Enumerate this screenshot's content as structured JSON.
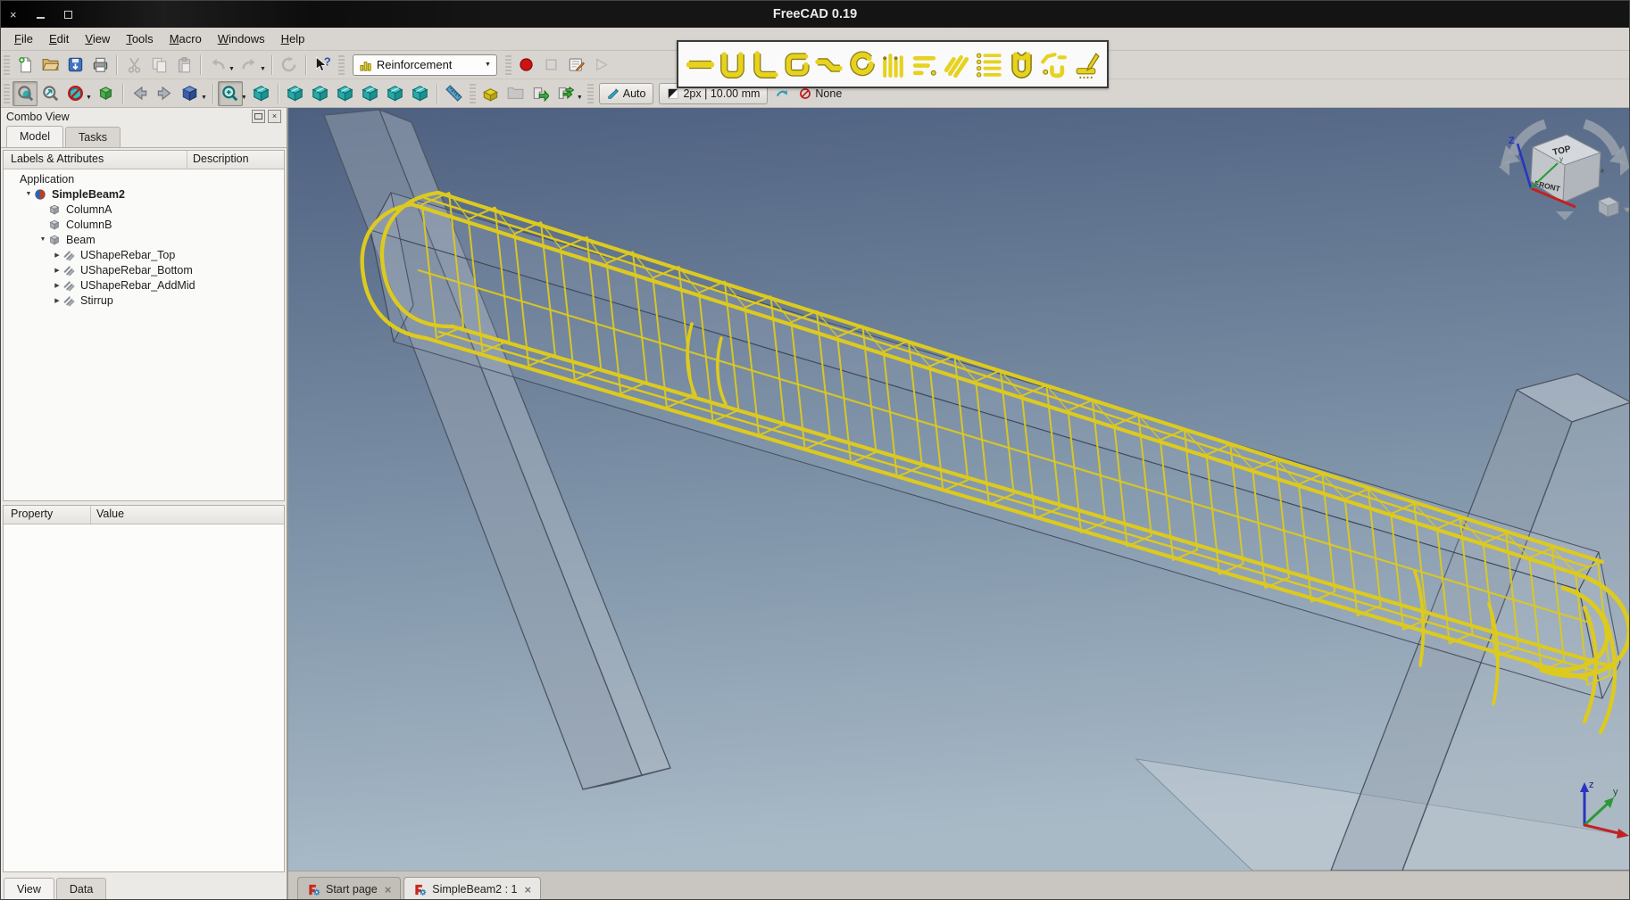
{
  "window": {
    "title": "FreeCAD 0.19",
    "controls": [
      "close",
      "minimize",
      "maximize"
    ]
  },
  "menubar": {
    "items": [
      "File",
      "Edit",
      "View",
      "Tools",
      "Macro",
      "Windows",
      "Help"
    ]
  },
  "toolbars": {
    "file": {
      "groups": [
        [
          "new-file",
          "open-folder",
          "save",
          "print"
        ],
        [
          "cut",
          "copy",
          "paste"
        ],
        [
          "undo",
          "dropdown",
          "redo",
          "dropdown"
        ],
        [
          "refresh"
        ],
        [
          "whats-this"
        ]
      ]
    },
    "workbench_selector": {
      "value": "Reinforcement",
      "icon": "workbench-rebar"
    },
    "macro": {
      "items": [
        "record-macro",
        "stop-macro",
        "edit-macro",
        "play-macro"
      ]
    },
    "view": {
      "groups": [
        [
          "fit-all",
          "fit-selection",
          "draw-style",
          "dropdown",
          "scene-box"
        ],
        [
          "nav-back",
          "nav-forward",
          "view-isometric",
          "dropdown"
        ],
        [
          "box-zoom",
          "dropdown",
          "view-axonometric"
        ],
        [
          "view-front",
          "view-top",
          "view-right",
          "view-rear",
          "view-bottom",
          "view-left"
        ],
        [
          "measure"
        ]
      ]
    },
    "arch": {
      "items": [
        "arch-component",
        "arch-folder",
        "arch-export",
        "arch-share",
        "dropdown"
      ]
    },
    "tracking": {
      "auto_label": "Auto",
      "line_label": "2px | 10.00 mm",
      "none_label": "None"
    },
    "rebar_tools": {
      "items": [
        "rebar-straight",
        "rebar-ushape",
        "rebar-lshape",
        "rebar-bentshape",
        "rebar-leyshape",
        "rebar-helical",
        "rebar-column",
        "rebar-beam",
        "rebar-slanted",
        "rebar-footing",
        "rebar-stirrup",
        "rebar-custom",
        "rebar-drawing"
      ]
    }
  },
  "combo_view": {
    "title": "Combo View",
    "tabs": [
      {
        "label": "Model",
        "active": true
      },
      {
        "label": "Tasks",
        "active": false
      }
    ],
    "tree_header": {
      "labels": "Labels & Attributes",
      "description": "Description"
    },
    "tree": [
      {
        "label": "Application",
        "depth": 0,
        "icon": null,
        "arrow": null,
        "bold": false
      },
      {
        "label": "SimpleBeam2",
        "depth": 1,
        "icon": "document",
        "arrow": "down",
        "bold": true
      },
      {
        "label": "ColumnA",
        "depth": 2,
        "icon": "structure",
        "arrow": null,
        "bold": false
      },
      {
        "label": "ColumnB",
        "depth": 2,
        "icon": "structure",
        "arrow": null,
        "bold": false
      },
      {
        "label": "Beam",
        "depth": 2,
        "icon": "structure",
        "arrow": "down",
        "bold": false
      },
      {
        "label": "UShapeRebar_Top",
        "depth": 3,
        "icon": "rebar",
        "arrow": "right",
        "bold": false
      },
      {
        "label": "UShapeRebar_Bottom",
        "depth": 3,
        "icon": "rebar",
        "arrow": "right",
        "bold": false
      },
      {
        "label": "UShapeRebar_AddMid",
        "depth": 3,
        "icon": "rebar",
        "arrow": "right",
        "bold": false
      },
      {
        "label": "Stirrup",
        "depth": 3,
        "icon": "rebar",
        "arrow": "right",
        "bold": false
      }
    ],
    "property_panel": {
      "columns": [
        "Property",
        "Value"
      ]
    },
    "bottom_tabs": [
      {
        "label": "View",
        "active": true
      },
      {
        "label": "Data",
        "active": false
      }
    ]
  },
  "document_tabs": [
    {
      "label": "Start page",
      "active": false
    },
    {
      "label": "SimpleBeam2 : 1",
      "active": true
    }
  ],
  "viewport": {
    "navigation_cube": {
      "top_label": "TOP",
      "front_label": "FRONT"
    },
    "axis_indicator": {
      "x": "x",
      "y": "y",
      "z": "z"
    }
  },
  "colors": {
    "rebar_yellow": "#ddca1e",
    "viewport_top": "#4e6080",
    "viewport_bottom": "#a9bac7",
    "toolbar_bg": "#d8d4cf",
    "titlebar_bg": "#151515",
    "cube_teal": "#2ab5b5"
  }
}
